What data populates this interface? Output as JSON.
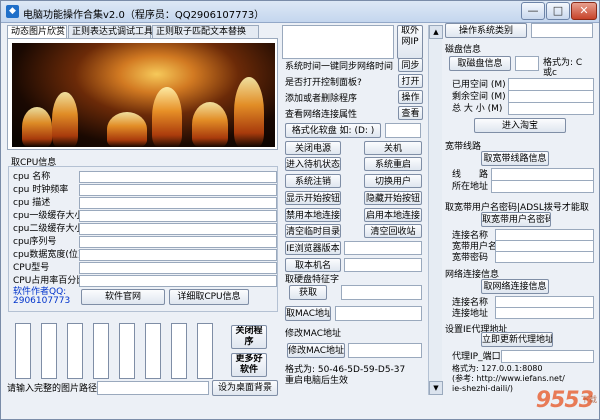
{
  "window": {
    "title": "电脑功能操作合集v2.0（程序员：QQ2906107773）",
    "minimize_glyph": "—",
    "maximize_glyph": "□",
    "close_glyph": "✕"
  },
  "tabs": [
    {
      "label": "动态图片欣赏"
    },
    {
      "label": "正则表达式调试工具"
    },
    {
      "label": "正则取子匹配文本替换"
    }
  ],
  "cpu": {
    "group_title": "取CPU信息",
    "rows": [
      {
        "label": "cpu 名称"
      },
      {
        "label": "cpu 时钟频率"
      },
      {
        "label": "cpu 描述"
      },
      {
        "label": "cpu一级缓存大小"
      },
      {
        "label": "cpu二级缓存大小"
      },
      {
        "label": "cpu序列号"
      },
      {
        "label": "cpu数据宽度(位)"
      },
      {
        "label": "CPU型号"
      },
      {
        "label": "CPU占用率百分比"
      }
    ],
    "author_label": "软件作者QQ:",
    "author_qq": "2906107773",
    "official_site_button": "软件官网",
    "detail_button": "详细取CPU信息"
  },
  "bottom_left": {
    "close_program_button": "关闭程序",
    "more_software_button": "更多好软件",
    "image_path_label": "请输入完整的图片路径",
    "set_wallpaper_button": "设为桌面背景"
  },
  "middle": {
    "get_external_ip_button": "取外网IP",
    "sync_button": "同步",
    "open_button": "打开",
    "operate_button": "操作",
    "view_button": "查看",
    "text_lines": [
      "系统时间一键同步网络时间",
      "是否打开控制面板?",
      "添加或者删除程序",
      "查看网络连接属性"
    ],
    "format_button": "格式化软盘 如: (D: )",
    "buttons_left": [
      "关闭电源",
      "进入待机状态",
      "系统注销",
      "显示开始按钮",
      "禁用本地连接",
      "清空临时目录",
      "IE浏览器版本",
      "取本机名"
    ],
    "buttons_right": [
      "关机",
      "系统重启",
      "切换用户",
      "隐藏开始按钮",
      "启用本地连接",
      "清空回收站"
    ],
    "hdd_group_title": "取硬盘特征字",
    "hdd_get_button": "获取",
    "mac_get_button": "取MAC地址",
    "mac_group_title": "修改MAC地址",
    "mac_modify_button": "修改MAC地址为",
    "mac_format_text": "格式为: 50-46-5D-59-D5-37",
    "mac_restart_text": "重启电脑后生效"
  },
  "right": {
    "os_type_button": "操作系统类别",
    "disk_group_title": "磁盘信息",
    "disk_get_button": "取磁盘信息",
    "disk_format_text": "格式为: C",
    "disk_format_text2": "或c",
    "used_label": "已用空间 (M)",
    "free_label": "剩余空间 (M)",
    "total_label": "总 大 小 (M)",
    "taobao_button": "进入淘宝",
    "broadband_group_title": "宽带线路",
    "broadband_button": "取宽带线路信息",
    "line_label": "线　　路",
    "location_label": "所在地址",
    "account_group_title": "取宽带用户名密码|ADSL拨号才能取",
    "account_button": "取宽带用户名密码",
    "conn_name_label": "连接名称",
    "user_label": "宽带用户名",
    "pass_label": "宽带密码",
    "net_group_title": "网络连接信息",
    "net_button": "取网络连接信息",
    "net_name_label": "连接名称",
    "net_addr_label": "连接地址",
    "proxy_group_title": "设置IE代理地址",
    "proxy_button": "立即更新代理地址",
    "proxy_ip_label": "代理IP_端口",
    "proxy_format_text": "格式为: 127.0.0.1:8080",
    "proxy_ref_text": "(参考: http://www.iefans.net/",
    "proxy_ref_text2": "ie-shezhi-daili/)"
  },
  "watermark": {
    "text": "9553",
    "sub": "下载"
  }
}
